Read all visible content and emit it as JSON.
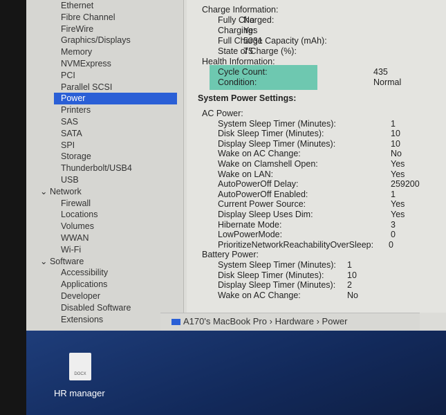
{
  "sidebar": {
    "items": [
      {
        "label": "Ethernet"
      },
      {
        "label": "Fibre Channel"
      },
      {
        "label": "FireWire"
      },
      {
        "label": "Graphics/Displays"
      },
      {
        "label": "Memory"
      },
      {
        "label": "NVMExpress"
      },
      {
        "label": "PCI"
      },
      {
        "label": "Parallel SCSI"
      },
      {
        "label": "Power",
        "selected": true
      },
      {
        "label": "Printers"
      },
      {
        "label": "SAS"
      },
      {
        "label": "SATA"
      },
      {
        "label": "SPI"
      },
      {
        "label": "Storage"
      },
      {
        "label": "Thunderbolt/USB4"
      },
      {
        "label": "USB"
      },
      {
        "label": "Network",
        "section": true
      },
      {
        "label": "Firewall"
      },
      {
        "label": "Locations"
      },
      {
        "label": "Volumes"
      },
      {
        "label": "WWAN"
      },
      {
        "label": "Wi-Fi"
      },
      {
        "label": "Software",
        "section": true
      },
      {
        "label": "Accessibility"
      },
      {
        "label": "Applications"
      },
      {
        "label": "Developer"
      },
      {
        "label": "Disabled Software"
      },
      {
        "label": "Extensions"
      }
    ]
  },
  "content": {
    "rows": [
      {
        "l": "Charge Information:",
        "i": 0
      },
      {
        "l": "Fully Charged:",
        "v": "No",
        "i": 1,
        "c": 1
      },
      {
        "l": "Charging:",
        "v": "Yes",
        "i": 1,
        "c": 1
      },
      {
        "l": "Full Charge Capacity (mAh):",
        "v": "5031",
        "i": 1,
        "c": 1
      },
      {
        "l": "State of Charge (%):",
        "v": "75",
        "i": 1,
        "c": 1
      },
      {
        "l": "Health Information:",
        "i": 0
      },
      {
        "l": "Cycle Count:",
        "v": "435",
        "i": 1,
        "c": 0
      },
      {
        "l": "Condition:",
        "v": "Normal",
        "i": 1,
        "c": 0
      },
      {
        "l": "System Power Settings:",
        "i": -1,
        "bold": true
      },
      {
        "l": "AC Power:",
        "i": 0
      },
      {
        "l": "System Sleep Timer (Minutes):",
        "v": "1",
        "i": 1,
        "c": 2
      },
      {
        "l": "Disk Sleep Timer (Minutes):",
        "v": "10",
        "i": 1,
        "c": 2
      },
      {
        "l": "Display Sleep Timer (Minutes):",
        "v": "10",
        "i": 1,
        "c": 2
      },
      {
        "l": "Wake on AC Change:",
        "v": "No",
        "i": 1,
        "c": 2
      },
      {
        "l": "Wake on Clamshell Open:",
        "v": "Yes",
        "i": 1,
        "c": 2
      },
      {
        "l": "Wake on LAN:",
        "v": "Yes",
        "i": 1,
        "c": 2
      },
      {
        "l": "AutoPowerOff Delay:",
        "v": "259200",
        "i": 1,
        "c": 2
      },
      {
        "l": "AutoPowerOff Enabled:",
        "v": "1",
        "i": 1,
        "c": 2
      },
      {
        "l": "Current Power Source:",
        "v": "Yes",
        "i": 1,
        "c": 2
      },
      {
        "l": "Display Sleep Uses Dim:",
        "v": "Yes",
        "i": 1,
        "c": 2
      },
      {
        "l": "Hibernate Mode:",
        "v": "3",
        "i": 1,
        "c": 2
      },
      {
        "l": "LowPowerMode:",
        "v": "0",
        "i": 1,
        "c": 2
      },
      {
        "l": "PrioritizeNetworkReachabilityOverSleep:",
        "v": "0",
        "i": 1,
        "c": 3
      },
      {
        "l": "Battery Power:",
        "i": 0
      },
      {
        "l": "System Sleep Timer (Minutes):",
        "v": "1",
        "i": 1,
        "c": 4
      },
      {
        "l": "Disk Sleep Timer (Minutes):",
        "v": "10",
        "i": 1,
        "c": 4
      },
      {
        "l": "Display Sleep Timer (Minutes):",
        "v": "2",
        "i": 1,
        "c": 4
      },
      {
        "l": "Wake on AC Change:",
        "v": "No",
        "i": 1,
        "c": 4
      }
    ]
  },
  "path": {
    "computer": "A170's MacBook Pro",
    "sep": "›",
    "section": "Hardware",
    "item": "Power"
  },
  "desktop": {
    "file_name": "HR manager",
    "file_type": "DOCX"
  },
  "colors": {
    "selection": "#2a5fd6",
    "highlight": "#6ec8b0"
  }
}
